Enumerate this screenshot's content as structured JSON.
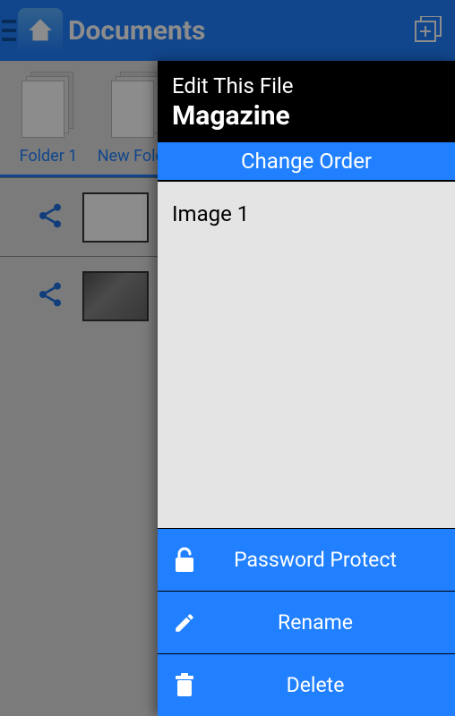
{
  "appbar": {
    "title": "Documents"
  },
  "folders": {
    "items": [
      {
        "label": "Folder 1"
      },
      {
        "label": "New Folder"
      }
    ]
  },
  "panel": {
    "header_sub": "Edit This File",
    "header_title": "Magazine",
    "change_order_label": "Change Order",
    "list": {
      "items": [
        {
          "label": "Image 1"
        }
      ]
    },
    "actions": {
      "password_protect": "Password Protect",
      "rename": "Rename",
      "delete": "Delete"
    }
  }
}
